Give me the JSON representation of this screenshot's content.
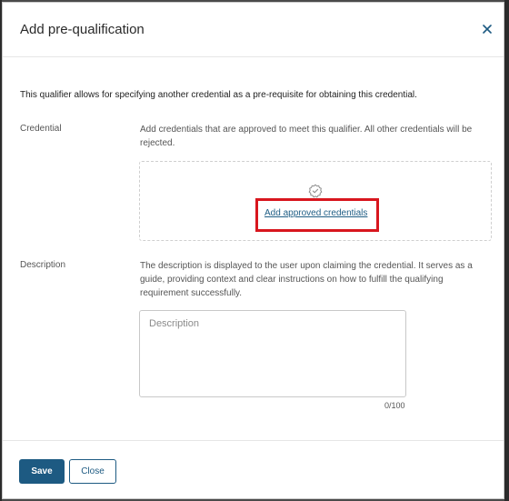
{
  "dialog": {
    "title": "Add pre-qualification",
    "close_icon": "close-icon"
  },
  "intro": "This qualifier allows for specifying another credential as a pre-requisite for obtaining this credential.",
  "credential": {
    "label": "Credential",
    "help": "Add credentials that are approved to meet this qualifier. All other credentials will be rejected.",
    "icon": "verified-badge-icon",
    "add_link": "Add approved credentials",
    "highlight_color": "#d8161e"
  },
  "description": {
    "label": "Description",
    "help": "The description is displayed to the user upon claiming the credential. It serves as a guide, providing context and clear instructions on how to fulfill the qualifying requirement successfully.",
    "placeholder": "Description",
    "value": "",
    "counter": "0/100"
  },
  "footer": {
    "save_label": "Save",
    "close_label": "Close",
    "accent": "#1d5a82"
  }
}
